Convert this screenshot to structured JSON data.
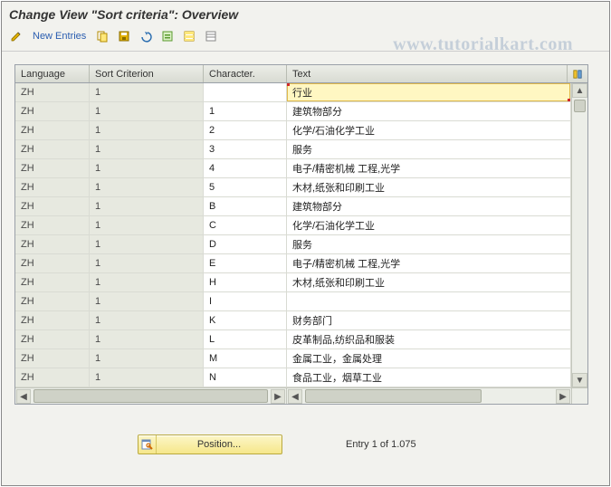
{
  "title": "Change View \"Sort criteria\": Overview",
  "watermark": "www.tutorialkart.com",
  "toolbar": {
    "new_entries": "New Entries"
  },
  "columns": {
    "language": "Language",
    "sort_criterion": "Sort Criterion",
    "character": "Character.",
    "text": "Text"
  },
  "rows": [
    {
      "lang": "ZH",
      "sort": "1",
      "char": "",
      "text": "行业"
    },
    {
      "lang": "ZH",
      "sort": "1",
      "char": "1",
      "text": "建筑物部分"
    },
    {
      "lang": "ZH",
      "sort": "1",
      "char": "2",
      "text": "化学/石油化学工业"
    },
    {
      "lang": "ZH",
      "sort": "1",
      "char": "3",
      "text": "服务"
    },
    {
      "lang": "ZH",
      "sort": "1",
      "char": "4",
      "text": "电子/精密机械 工程,光学"
    },
    {
      "lang": "ZH",
      "sort": "1",
      "char": "5",
      "text": "木材,纸张和印刷工业"
    },
    {
      "lang": "ZH",
      "sort": "1",
      "char": "B",
      "text": "建筑物部分"
    },
    {
      "lang": "ZH",
      "sort": "1",
      "char": "C",
      "text": "化学/石油化学工业"
    },
    {
      "lang": "ZH",
      "sort": "1",
      "char": "D",
      "text": "服务"
    },
    {
      "lang": "ZH",
      "sort": "1",
      "char": "E",
      "text": "电子/精密机械 工程,光学"
    },
    {
      "lang": "ZH",
      "sort": "1",
      "char": "H",
      "text": "木材,纸张和印刷工业"
    },
    {
      "lang": "ZH",
      "sort": "1",
      "char": "I",
      "text": ""
    },
    {
      "lang": "ZH",
      "sort": "1",
      "char": "K",
      "text": "财务部门"
    },
    {
      "lang": "ZH",
      "sort": "1",
      "char": "L",
      "text": "皮革制品,纺织品和服装"
    },
    {
      "lang": "ZH",
      "sort": "1",
      "char": "M",
      "text": "金属工业，金属处理"
    },
    {
      "lang": "ZH",
      "sort": "1",
      "char": "N",
      "text": "食品工业，烟草工业"
    }
  ],
  "footer": {
    "position_label": "Position...",
    "entry_text": "Entry 1 of 1.075"
  }
}
